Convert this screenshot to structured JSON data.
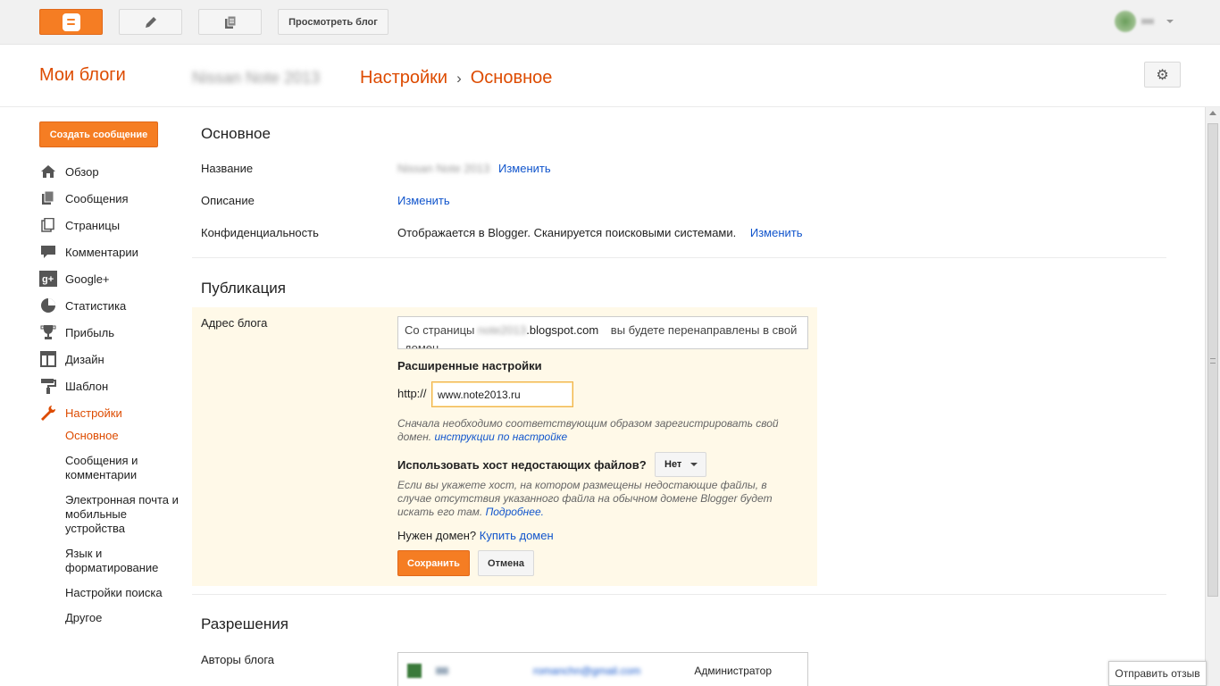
{
  "topbar": {
    "view_blog_label": "Просмотреть блог",
    "icons": {
      "blogger": "blogger-logo-icon",
      "edit": "pencil-icon",
      "posts": "posts-icon"
    }
  },
  "header": {
    "my_blogs": "Мои блоги",
    "blog_name": "Nissan Note 2013",
    "crumb_settings": "Настройки",
    "crumb_separator": "›",
    "crumb_basic": "Основное"
  },
  "sidebar": {
    "create_post": "Создать сообщение",
    "items": [
      {
        "label": "Обзор",
        "icon": "home-icon"
      },
      {
        "label": "Сообщения",
        "icon": "posts-icon"
      },
      {
        "label": "Страницы",
        "icon": "pages-icon"
      },
      {
        "label": "Комментарии",
        "icon": "comment-icon"
      },
      {
        "label": "Google+",
        "icon": "google-plus-icon"
      },
      {
        "label": "Статистика",
        "icon": "pie-chart-icon"
      },
      {
        "label": "Прибыль",
        "icon": "trophy-icon"
      },
      {
        "label": "Дизайн",
        "icon": "layout-icon"
      },
      {
        "label": "Шаблон",
        "icon": "paint-roller-icon"
      },
      {
        "label": "Настройки",
        "icon": "wrench-icon"
      }
    ],
    "subitems": [
      "Основное",
      "Сообщения и комментарии",
      "Электронная почта и мобильные устройства",
      "Язык и форматирование",
      "Настройки поиска",
      "Другое"
    ]
  },
  "basic": {
    "title": "Основное",
    "name_label": "Название",
    "name_value": "Nissan Note 2013",
    "change": "Изменить",
    "description_label": "Описание",
    "privacy_label": "Конфиденциальность",
    "privacy_value": "Отображается в Blogger. Сканируется поисковыми системами."
  },
  "publishing": {
    "title": "Публикация",
    "address_label": "Адрес блога",
    "redirect_prefix": "Со страницы",
    "redirect_blurred": "note2013",
    "redirect_domain": ".blogspot.com",
    "redirect_suffix": "вы будете перенаправлены в свой домен.",
    "advanced_title": "Расширенные настройки",
    "http_label": "http://",
    "url_value": "www.note2013.ru",
    "hint_register": "Сначала необходимо соответствующим образом зарегистрировать свой домен.",
    "hint_register_link": "инструкции по настройке",
    "host_question": "Использовать хост недостающих файлов?",
    "host_value": "Нет",
    "hint_host": "Если вы укажете хост, на котором размещены недостающие файлы, в случае отсутствия указанного файла на обычном домене Blogger будет искать его там.",
    "hint_host_link": "Подробнее.",
    "need_domain": "Нужен домен?",
    "buy_domain": "Купить домен",
    "save": "Сохранить",
    "cancel": "Отмена"
  },
  "permissions": {
    "title": "Разрешения",
    "authors_label": "Авторы блога",
    "author_name": "rc",
    "author_email": "romanchn@gmail.com",
    "author_role": "Администратор"
  },
  "feedback": "Отправить отзыв",
  "colors": {
    "accent": "#dd4b00",
    "button_orange": "#f57d23",
    "link": "#1155cc",
    "highlight_bg": "#fff9e8"
  }
}
